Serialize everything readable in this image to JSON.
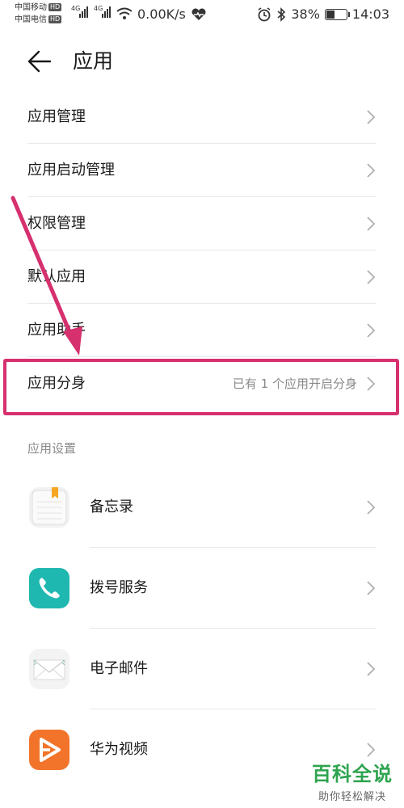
{
  "status_bar": {
    "carrier1": "中国移动",
    "carrier2": "中国电信",
    "hd": "HD",
    "net1": "4G",
    "net2": "4G",
    "speed": "0.00K/s",
    "battery_percent": "38%",
    "battery_level": 0.38,
    "time": "14:03"
  },
  "header": {
    "title": "应用",
    "back_icon": "arrow-left-icon"
  },
  "menu": [
    {
      "label": "应用管理"
    },
    {
      "label": "应用启动管理"
    },
    {
      "label": "权限管理"
    },
    {
      "label": "默认应用"
    },
    {
      "label": "应用助手"
    },
    {
      "label": "应用分身",
      "value": "已有 1 个应用开启分身"
    }
  ],
  "section": {
    "title": "应用设置"
  },
  "apps": [
    {
      "label": "备忘录",
      "icon": "notepad-icon"
    },
    {
      "label": "拨号服务",
      "icon": "phone-icon"
    },
    {
      "label": "电子邮件",
      "icon": "mail-icon"
    },
    {
      "label": "华为视频",
      "icon": "video-icon"
    }
  ],
  "watermark": {
    "main": "百科全说",
    "sub": "助你轻松解决"
  },
  "colors": {
    "highlight": "#d6306f",
    "phone": "#1fb8b0",
    "video": "#f2742a",
    "note_tab": "#f5a623",
    "watermark": "#2ea44f"
  }
}
